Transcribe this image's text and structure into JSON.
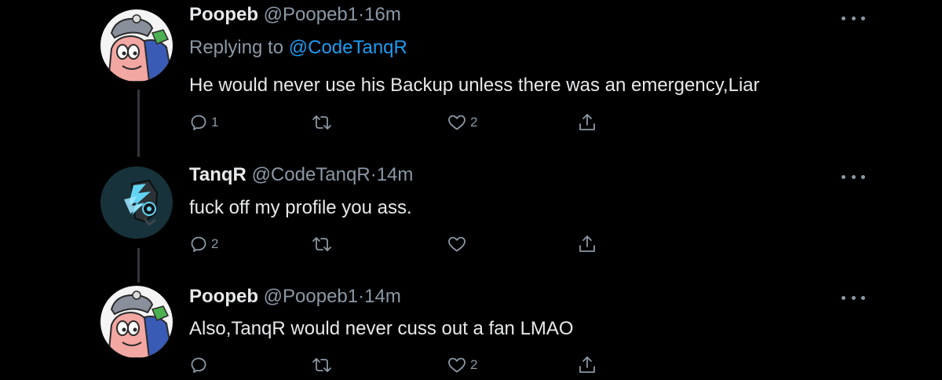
{
  "tweets": [
    {
      "name": "Poopeb",
      "handle": "@Poopeb1",
      "dot": "·",
      "time": "16m",
      "reply_prefix": "Replying to ",
      "reply_to": "@CodeTanqR",
      "text": "He would never use his Backup unless there was an emergency,Liar",
      "reply_count": "1",
      "retweet_count": "",
      "like_count": "2",
      "avatar_icon": "patrick-avatar"
    },
    {
      "name": "TanqR",
      "handle": "@CodeTanqR",
      "dot": "·",
      "time": "14m",
      "text": "fuck off my profile you ass.",
      "reply_count": "2",
      "retweet_count": "",
      "like_count": "",
      "avatar_icon": "tanqr-avatar"
    },
    {
      "name": "Poopeb",
      "handle": "@Poopeb1",
      "dot": "·",
      "time": "14m",
      "text": "Also,TanqR would never cuss out a fan LMAO",
      "reply_count": "",
      "retweet_count": "",
      "like_count": "2",
      "avatar_icon": "patrick-avatar"
    }
  ],
  "colors": {
    "background": "#000000",
    "text": "#e7e9ea",
    "secondary": "#8b98a5",
    "mention": "#1d9bf0",
    "thread_line": "#333639"
  }
}
